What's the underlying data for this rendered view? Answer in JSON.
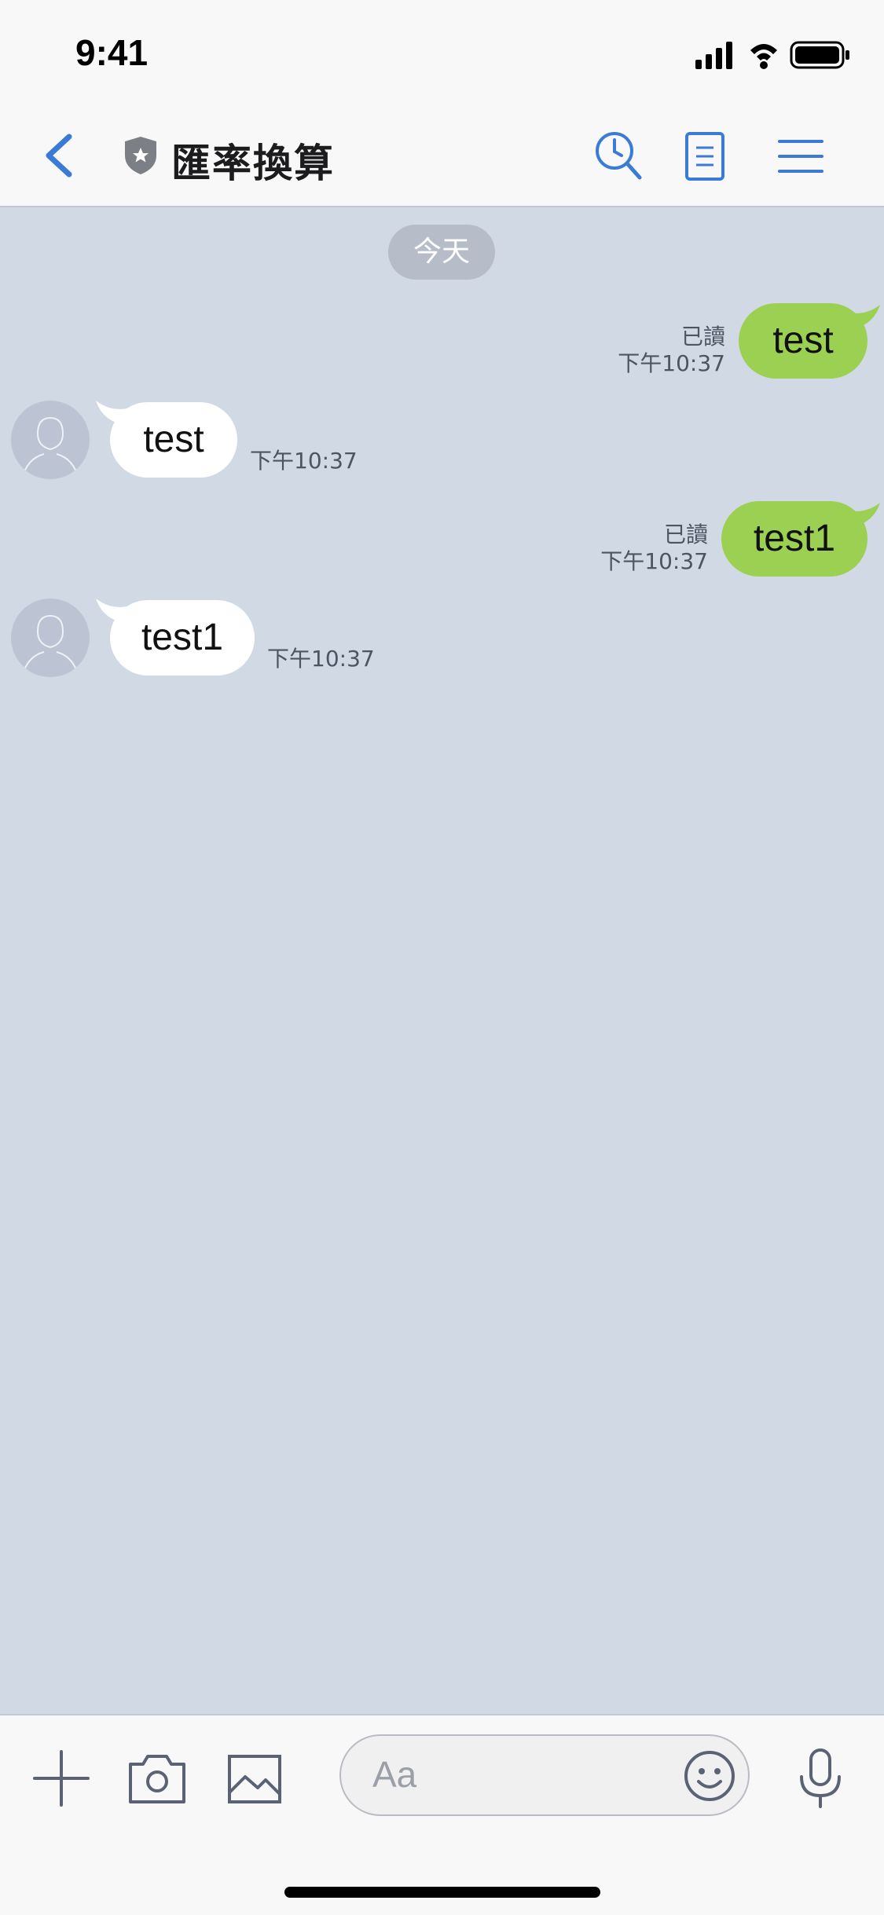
{
  "status_bar": {
    "time": "9:41"
  },
  "header": {
    "title": "匯率換算"
  },
  "chat": {
    "date_label": "今天",
    "messages": [
      {
        "direction": "out",
        "text": "test",
        "read": "已讀",
        "time": "下午10:37"
      },
      {
        "direction": "in",
        "text": "test",
        "time": "下午10:37"
      },
      {
        "direction": "out",
        "text": "test1",
        "read": "已讀",
        "time": "下午10:37"
      },
      {
        "direction": "in",
        "text": "test1",
        "time": "下午10:37"
      }
    ]
  },
  "input": {
    "placeholder": "Aa"
  },
  "colors": {
    "accent": "#3a7bd5",
    "out_bubble": "#9bd052",
    "in_bubble": "#ffffff",
    "chat_bg": "#d1d9e4"
  },
  "icons": [
    "signal-icon",
    "wifi-icon",
    "battery-icon",
    "back-icon",
    "shield-icon",
    "search-icon",
    "notes-icon",
    "menu-icon",
    "plus-icon",
    "camera-icon",
    "image-icon",
    "emoji-icon",
    "mic-icon"
  ]
}
